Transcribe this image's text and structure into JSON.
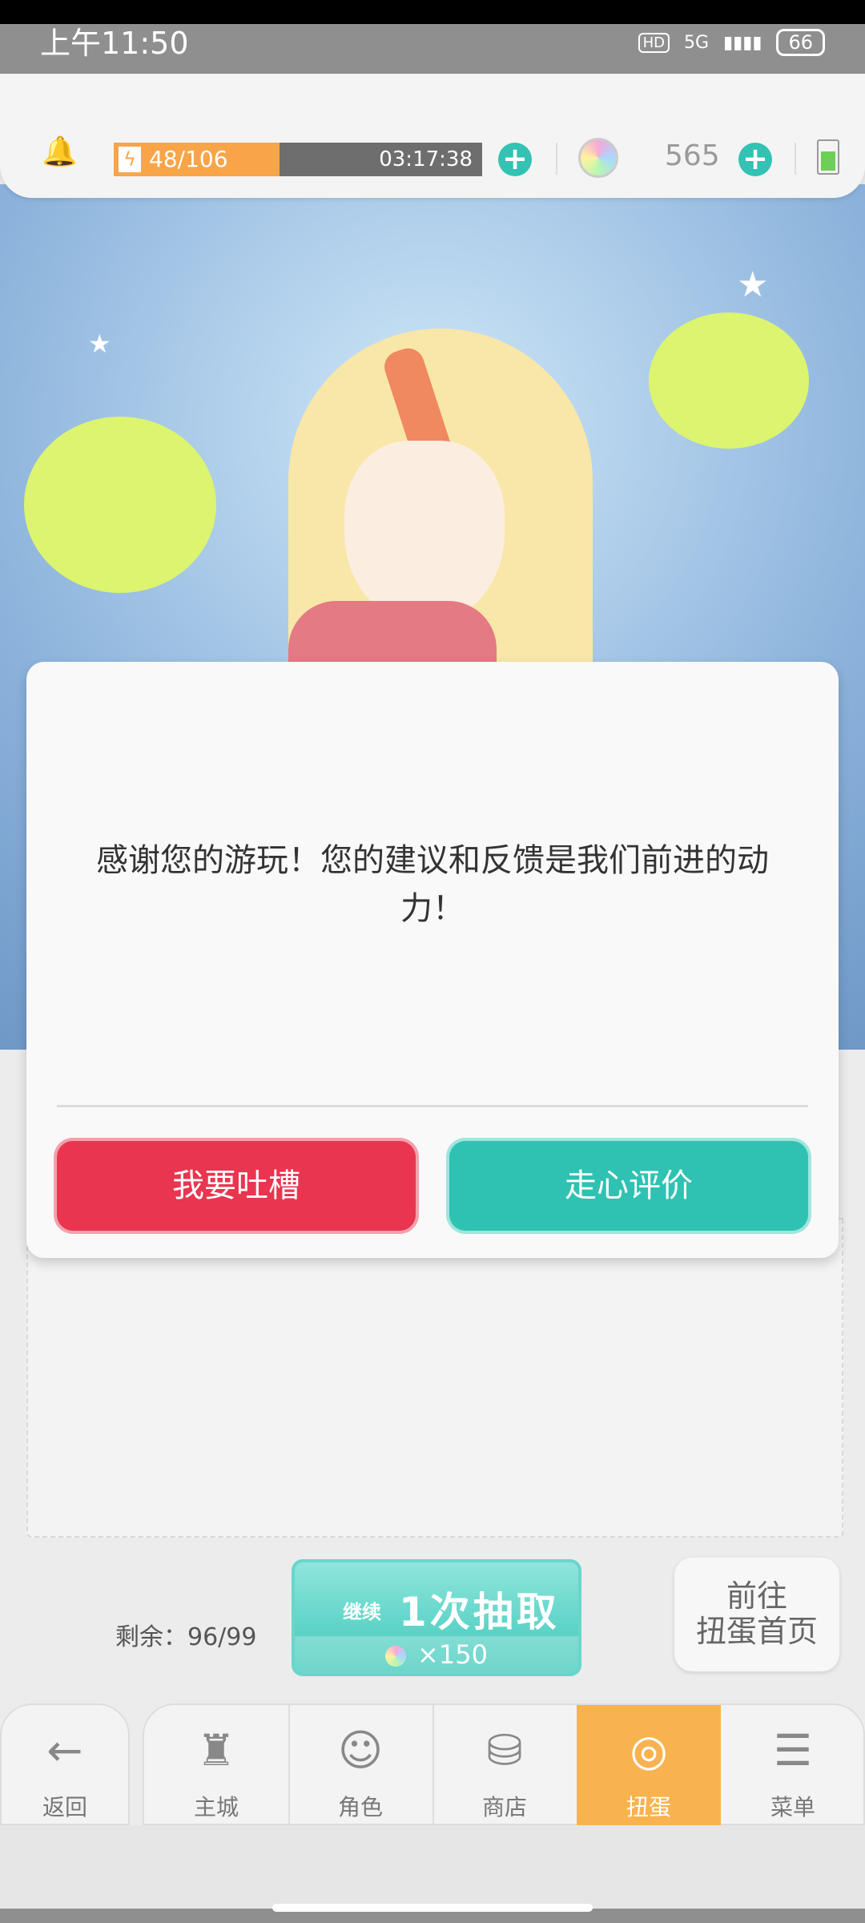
{
  "status": {
    "time": "上午11:50",
    "hd": "HD",
    "network": "5G",
    "battery": "66"
  },
  "resources": {
    "stamina_text": "48/106",
    "stamina_fraction": 0.45,
    "timer": "03:17:38",
    "gems": "565"
  },
  "dialog": {
    "message": "感谢您的游玩！您的建议和反馈是我们前进的动力！",
    "left_button": "我要吐槽",
    "right_button": "走心评价"
  },
  "gacha": {
    "remaining": "剩余：96/99",
    "continue_label": "继续",
    "draw_label": "1次抽取",
    "cost": "×150",
    "goto_label_1": "前往",
    "goto_label_2": "扭蛋首页"
  },
  "nav": {
    "back": "返回",
    "items": [
      {
        "label": "主城",
        "icon": "castle-icon"
      },
      {
        "label": "角色",
        "icon": "character-icon"
      },
      {
        "label": "商店",
        "icon": "shop-icon"
      },
      {
        "label": "扭蛋",
        "icon": "gacha-icon",
        "active": true
      },
      {
        "label": "菜单",
        "icon": "menu-icon"
      }
    ]
  },
  "colors": {
    "accent_teal": "#2fc2b2",
    "accent_red": "#e9354f",
    "stamina_orange": "#f8a549",
    "nav_active": "#f8b350"
  }
}
